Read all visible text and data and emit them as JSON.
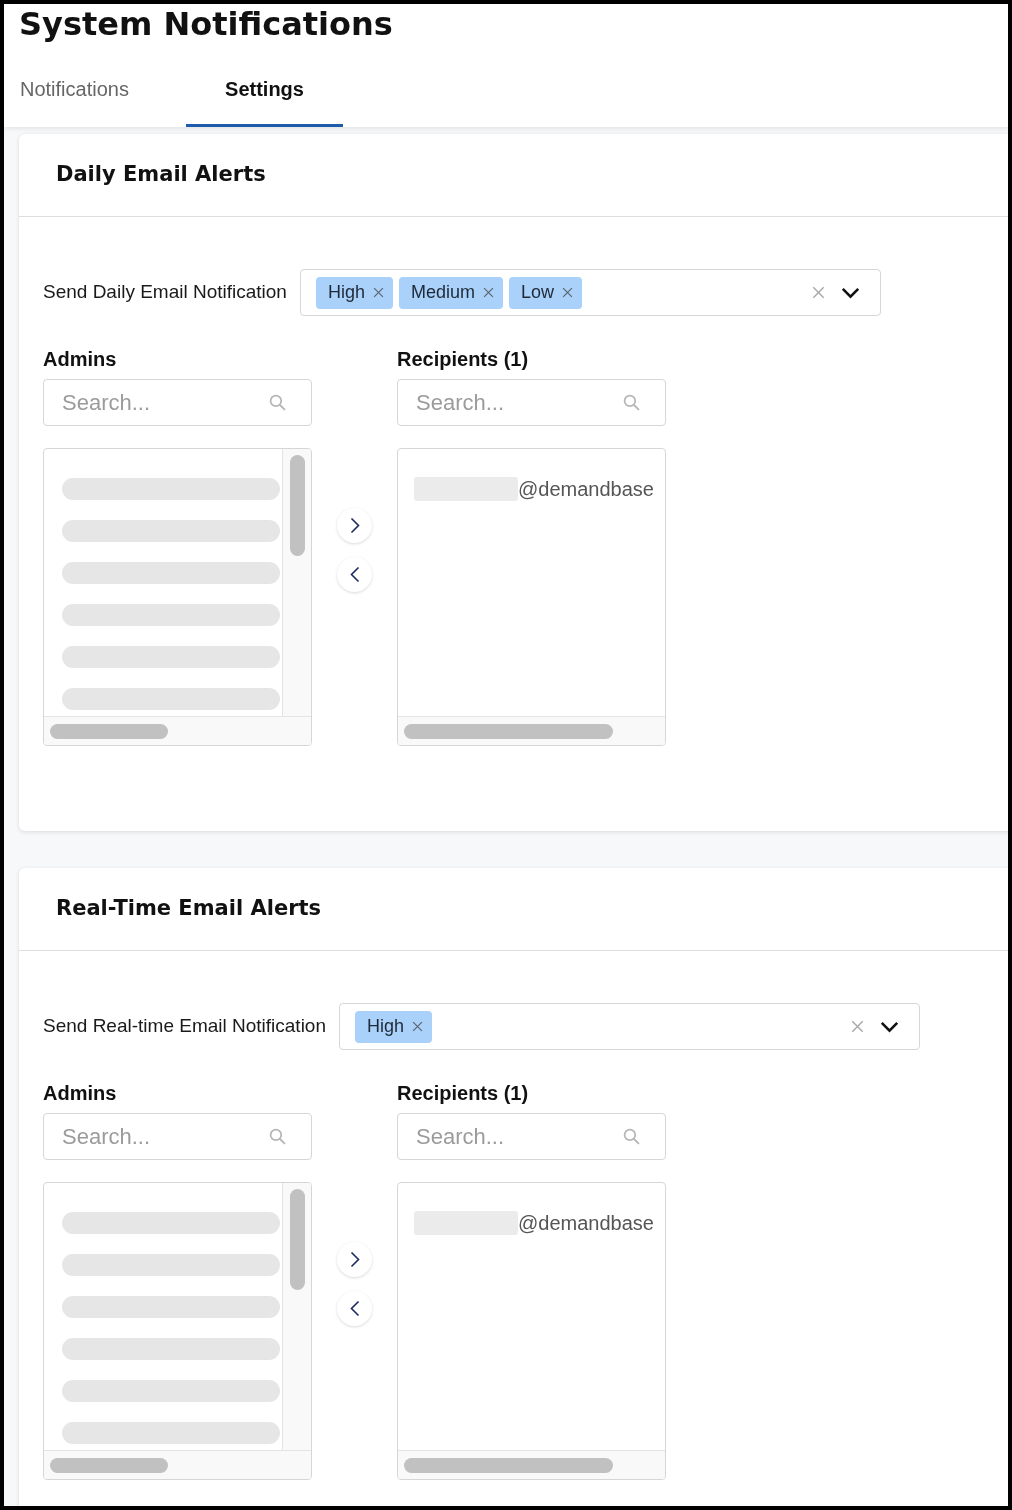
{
  "page": {
    "title": "System Notifications"
  },
  "tabs": [
    {
      "label": "Notifications",
      "selected": false
    },
    {
      "label": "Settings",
      "selected": true
    }
  ],
  "sections": [
    {
      "title": "Daily Email Alerts",
      "notification": {
        "label": "Send Daily Email Notification",
        "tags": [
          "High",
          "Medium",
          "Low"
        ]
      },
      "admins": {
        "heading": "Admins",
        "search": {
          "placeholder": "Search..."
        }
      },
      "recipients": {
        "heading": "Recipients (1)",
        "search": {
          "placeholder": "Search..."
        },
        "items": [
          "@demandbase"
        ]
      }
    },
    {
      "title": "Real-Time Email Alerts",
      "notification": {
        "label": "Send Real-time Email Notification",
        "tags": [
          "High"
        ]
      },
      "admins": {
        "heading": "Admins",
        "search": {
          "placeholder": "Search..."
        }
      },
      "recipients": {
        "heading": "Recipients (1)",
        "search": {
          "placeholder": "Search..."
        },
        "items": [
          "@demandbase"
        ]
      }
    }
  ]
}
